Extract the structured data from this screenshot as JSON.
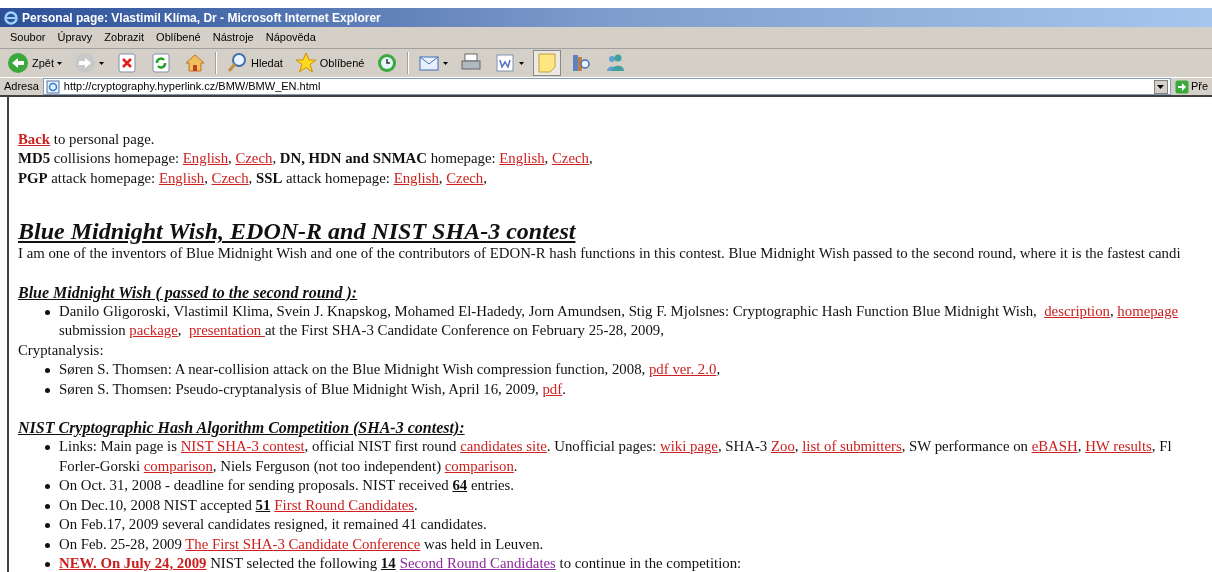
{
  "window": {
    "title": "Personal page: Vlastimil Klíma, Dr - Microsoft Internet Explorer"
  },
  "menu": [
    "Soubor",
    "Úpravy",
    "Zobrazit",
    "Oblíbené",
    "Nástroje",
    "Nápověda"
  ],
  "toolbar": [
    {
      "kind": "back",
      "label": "Zpět",
      "dropdown": true,
      "pressed": false
    },
    {
      "kind": "forward",
      "dropdown": true,
      "pressed": false
    },
    {
      "kind": "stop",
      "dropdown": false,
      "pressed": false
    },
    {
      "kind": "refresh",
      "dropdown": false,
      "pressed": false
    },
    {
      "kind": "home",
      "dropdown": false,
      "pressed": false
    },
    {
      "kind": "separator"
    },
    {
      "kind": "search",
      "label": "Hledat",
      "dropdown": false,
      "pressed": false
    },
    {
      "kind": "favorites",
      "label": "Oblíbené",
      "dropdown": false,
      "pressed": false
    },
    {
      "kind": "history",
      "dropdown": false,
      "pressed": false
    },
    {
      "kind": "separator"
    },
    {
      "kind": "mail",
      "dropdown": true,
      "pressed": false
    },
    {
      "kind": "print",
      "dropdown": false,
      "pressed": false
    },
    {
      "kind": "edit",
      "dropdown": true,
      "pressed": false
    },
    {
      "kind": "notes",
      "dropdown": false,
      "pressed": true
    },
    {
      "kind": "research",
      "dropdown": false,
      "pressed": false
    },
    {
      "kind": "messenger",
      "dropdown": false,
      "pressed": false
    }
  ],
  "address_bar": {
    "label": "Adresa",
    "url": "http://cryptography.hyperlink.cz/BMW/BMW_EN.html",
    "go_label": "Pře"
  },
  "content": [
    {
      "kind": "line",
      "lines": [
        [
          {
            "kind": "bold_link",
            "text": "Back"
          },
          {
            "kind": "text",
            "text": " to personal page."
          }
        ]
      ]
    },
    {
      "kind": "line",
      "lines": [
        [
          {
            "kind": "bold",
            "text": "MD5"
          },
          {
            "kind": "text",
            "text": " collisions homepage: "
          },
          {
            "kind": "link",
            "text": "English"
          },
          {
            "kind": "text",
            "text": ", "
          },
          {
            "kind": "link",
            "text": "Czech"
          },
          {
            "kind": "text",
            "text": ", "
          },
          {
            "kind": "bold",
            "text": "DN, HDN and SNMAC"
          },
          {
            "kind": "text",
            "text": " homepage: "
          },
          {
            "kind": "link",
            "text": "English"
          },
          {
            "kind": "text",
            "text": ", "
          },
          {
            "kind": "link",
            "text": "Czech"
          },
          {
            "kind": "text",
            "text": ","
          }
        ]
      ]
    },
    {
      "kind": "line",
      "lines": [
        [
          {
            "kind": "bold",
            "text": "PGP"
          },
          {
            "kind": "text",
            "text": " attack homepage: "
          },
          {
            "kind": "link",
            "text": "English"
          },
          {
            "kind": "text",
            "text": ", "
          },
          {
            "kind": "link",
            "text": "Czech"
          },
          {
            "kind": "text",
            "text": ", "
          },
          {
            "kind": "bold",
            "text": "SSL"
          },
          {
            "kind": "text",
            "text": " attack homepage: "
          },
          {
            "kind": "link",
            "text": "English"
          },
          {
            "kind": "text",
            "text": ", "
          },
          {
            "kind": "link",
            "text": "Czech"
          },
          {
            "kind": "text",
            "text": ","
          }
        ]
      ]
    },
    {
      "kind": "heading",
      "text": "Blue Midnight Wish, EDON-R and NIST SHA-3 contest"
    },
    {
      "kind": "line",
      "lines": [
        [
          {
            "kind": "text",
            "text": "I am one of the inventors of Blue Midnight Wish and one of the contributors of EDON-R hash functions in this contest. Blue Midnight Wish passed to the second round, where it is the fastest candi"
          }
        ]
      ]
    },
    {
      "kind": "subheading",
      "text": "Blue Midnight Wish ( passed to the second round ):"
    },
    {
      "kind": "bullet",
      "lines": [
        [
          {
            "kind": "text",
            "text": "Danilo Gligoroski, Vlastimil Klima, Svein J. Knapskog, Mohamed El-Hadedy, Jorn Amundsen, Stig F. Mjolsnes: Cryptographic Hash Function Blue Midnight Wish,  "
          },
          {
            "kind": "link",
            "text": "description"
          },
          {
            "kind": "text",
            "text": ", "
          },
          {
            "kind": "link",
            "text": "homepage"
          }
        ],
        [
          {
            "kind": "text",
            "text": "submission "
          },
          {
            "kind": "link",
            "text": "package"
          },
          {
            "kind": "text",
            "text": ",  "
          },
          {
            "kind": "link",
            "text": "presentation "
          },
          {
            "kind": "text",
            "text": "at the First SHA-3 Candidate Conference on February 25-28, 2009,"
          }
        ]
      ]
    },
    {
      "kind": "line",
      "lines": [
        [
          {
            "kind": "text",
            "text": "Cryptanalysis:"
          }
        ]
      ]
    },
    {
      "kind": "bullet",
      "lines": [
        [
          {
            "kind": "text",
            "text": "Søren S. Thomsen: A near-collision attack on the Blue Midnight Wish compression function, 2008, "
          },
          {
            "kind": "link",
            "text": "pdf ver. 2.0"
          },
          {
            "kind": "text",
            "text": ","
          }
        ]
      ]
    },
    {
      "kind": "bullet",
      "lines": [
        [
          {
            "kind": "text",
            "text": "Søren S. Thomsen: Pseudo-cryptanalysis of Blue Midnight Wish, April 16, 2009, "
          },
          {
            "kind": "link",
            "text": "pdf"
          },
          {
            "kind": "text",
            "text": "."
          }
        ]
      ]
    },
    {
      "kind": "subheading",
      "text": "NIST Cryptographic Hash Algorithm Competition (SHA-3 contest):"
    },
    {
      "kind": "bullet",
      "lines": [
        [
          {
            "kind": "text",
            "text": "Links: Main page is "
          },
          {
            "kind": "link",
            "text": "NIST SHA-3 contest"
          },
          {
            "kind": "text",
            "text": ", official NIST first round "
          },
          {
            "kind": "link",
            "text": "candidates site"
          },
          {
            "kind": "text",
            "text": ". Unofficial pages: "
          },
          {
            "kind": "link",
            "text": "wiki page"
          },
          {
            "kind": "text",
            "text": ", SHA-3 "
          },
          {
            "kind": "link",
            "text": "Zoo"
          },
          {
            "kind": "text",
            "text": ", "
          },
          {
            "kind": "link",
            "text": "list of submitters"
          },
          {
            "kind": "text",
            "text": ", SW performance on "
          },
          {
            "kind": "link",
            "text": "eBASH"
          },
          {
            "kind": "text",
            "text": ", "
          },
          {
            "kind": "link",
            "text": "HW results"
          },
          {
            "kind": "text",
            "text": ", Fl"
          }
        ],
        [
          {
            "kind": "text",
            "text": "Forler-Gorski "
          },
          {
            "kind": "link",
            "text": "comparison"
          },
          {
            "kind": "text",
            "text": ", Niels Ferguson (not too independent) "
          },
          {
            "kind": "link",
            "text": "comparison"
          },
          {
            "kind": "text",
            "text": "."
          }
        ]
      ]
    },
    {
      "kind": "bullet",
      "lines": [
        [
          {
            "kind": "text",
            "text": "On Oct. 31, 2008 - deadline for sending proposals. NIST received "
          },
          {
            "kind": "count",
            "text": "64"
          },
          {
            "kind": "text",
            "text": " entries."
          }
        ]
      ]
    },
    {
      "kind": "bullet",
      "lines": [
        [
          {
            "kind": "text",
            "text": "On Dec.10, 2008 NIST accepted "
          },
          {
            "kind": "count",
            "text": "51"
          },
          {
            "kind": "link",
            "text": "First Round Candidates",
            "gap_before": true
          },
          {
            "kind": "text",
            "text": "."
          }
        ]
      ]
    },
    {
      "kind": "bullet",
      "lines": [
        [
          {
            "kind": "text",
            "text": "On Feb.17, 2009 several candidates resigned, it remained 41 candidates."
          }
        ]
      ]
    },
    {
      "kind": "bullet",
      "lines": [
        [
          {
            "kind": "text",
            "text": "On Feb. 25-28, 2009 "
          },
          {
            "kind": "link",
            "text": "The First SHA-3 Candidate Conference"
          },
          {
            "kind": "text",
            "text": " was held in Leuven."
          }
        ]
      ]
    },
    {
      "kind": "bullet",
      "lines": [
        [
          {
            "kind": "new",
            "text": "NEW. On July 24, 2009"
          },
          {
            "kind": "text",
            "text": " NIST selected the following "
          },
          {
            "kind": "count",
            "text": "14"
          },
          {
            "kind": "visited_link",
            "text": "Second Round Candidates",
            "gap_before": true
          },
          {
            "kind": "text",
            "text": " to continue in the competition:"
          }
        ]
      ]
    }
  ]
}
